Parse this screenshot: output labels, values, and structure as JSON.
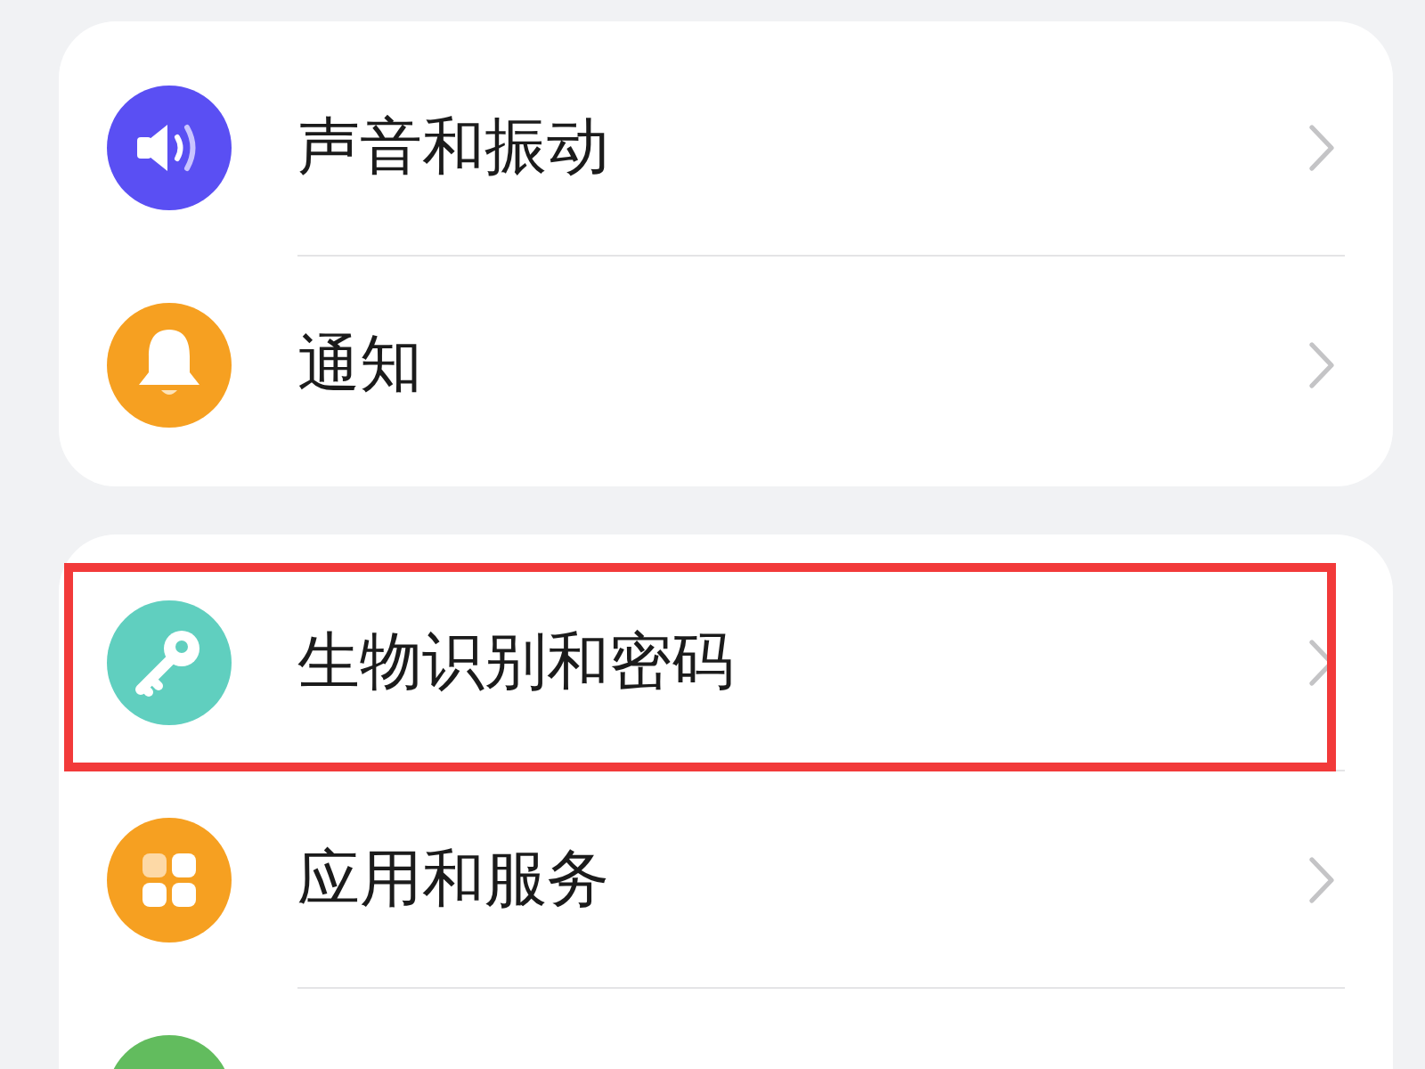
{
  "sections": [
    {
      "items": [
        {
          "kind": "sound",
          "label": "声音和振动",
          "color": "#5a4ff3",
          "highlighted": false
        },
        {
          "kind": "bell",
          "label": "通知",
          "color": "#f6a021",
          "highlighted": false
        }
      ]
    },
    {
      "items": [
        {
          "kind": "key",
          "label": "生物识别和密码",
          "color": "#60cfbf",
          "highlighted": true
        },
        {
          "kind": "apps",
          "label": "应用和服务",
          "color": "#f6a021",
          "highlighted": false
        },
        {
          "kind": "plain",
          "color": "#62bc5e",
          "highlighted": false
        }
      ]
    }
  ]
}
